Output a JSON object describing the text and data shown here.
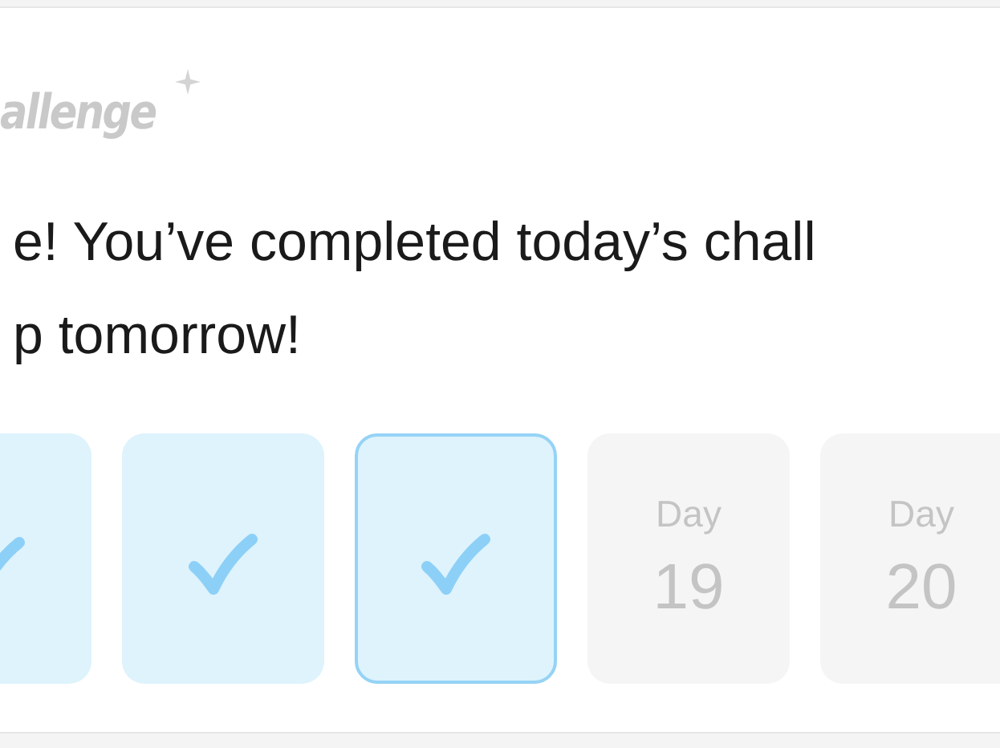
{
  "title": "allenge",
  "message": [
    "e! You’ve completed today’s chall",
    "p tomorrow!"
  ],
  "days": [
    {
      "kind": "done",
      "selected": false,
      "partial": true
    },
    {
      "kind": "done",
      "selected": false
    },
    {
      "kind": "done",
      "selected": true
    },
    {
      "kind": "upcoming",
      "selected": false,
      "label": "Day",
      "number": "19"
    },
    {
      "kind": "upcoming",
      "selected": false,
      "label": "Day",
      "number": "20"
    }
  ]
}
